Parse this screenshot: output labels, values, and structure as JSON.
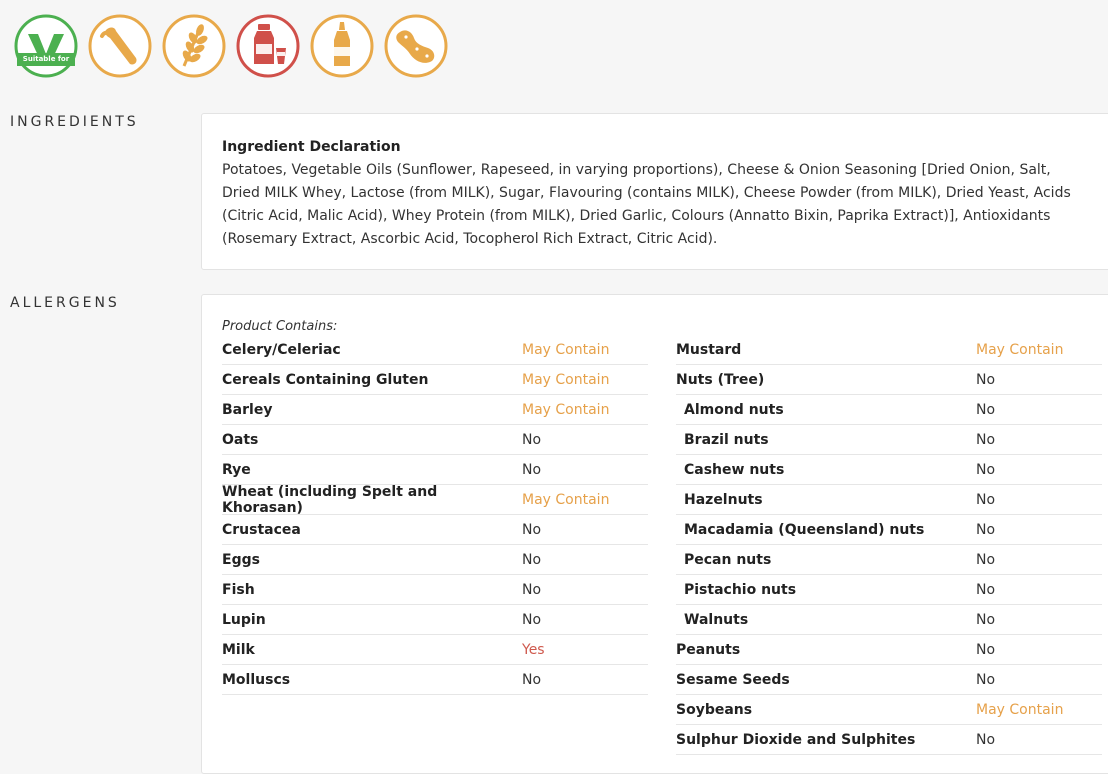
{
  "badges": {
    "vegetarian_label": "Suitable for",
    "vegetarian_letter": "V",
    "colors": {
      "green": "#4cb050",
      "amber": "#e8a94a",
      "red": "#d0504a"
    }
  },
  "ingredients": {
    "section_label": "INGREDIENTS",
    "title": "Ingredient Declaration",
    "text": "Potatoes, Vegetable Oils (Sunflower, Rapeseed, in varying proportions), Cheese & Onion Seasoning [Dried Onion, Salt, Dried MILK Whey, Lactose (from MILK), Sugar, Flavouring (contains MILK), Cheese Powder (from MILK), Dried Yeast, Acids (Citric Acid, Malic Acid), Whey Protein (from MILK), Dried Garlic, Colours (Annatto Bixin, Paprika Extract)], Antioxidants (Rosemary Extract, Ascorbic Acid, Tocopherol Rich Extract, Citric Acid)."
  },
  "allergens": {
    "section_label": "ALLERGENS",
    "contains_label": "Product Contains:",
    "left": [
      {
        "name": "Celery/Celeriac",
        "value": "May Contain",
        "status": "may",
        "sub": false
      },
      {
        "name": "Cereals Containing Gluten",
        "value": "May Contain",
        "status": "may",
        "sub": false
      },
      {
        "name": "Barley",
        "value": "May Contain",
        "status": "may",
        "sub": false
      },
      {
        "name": "Oats",
        "value": "No",
        "status": "no",
        "sub": false
      },
      {
        "name": "Rye",
        "value": "No",
        "status": "no",
        "sub": false
      },
      {
        "name": "Wheat (including Spelt and Khorasan)",
        "value": "May Contain",
        "status": "may",
        "sub": false
      },
      {
        "name": "Crustacea",
        "value": "No",
        "status": "no",
        "sub": false
      },
      {
        "name": "Eggs",
        "value": "No",
        "status": "no",
        "sub": false
      },
      {
        "name": "Fish",
        "value": "No",
        "status": "no",
        "sub": false
      },
      {
        "name": "Lupin",
        "value": "No",
        "status": "no",
        "sub": false
      },
      {
        "name": "Milk",
        "value": "Yes",
        "status": "yes",
        "sub": false
      },
      {
        "name": "Molluscs",
        "value": "No",
        "status": "no",
        "sub": false
      }
    ],
    "right": [
      {
        "name": "Mustard",
        "value": "May Contain",
        "status": "may",
        "sub": false
      },
      {
        "name": "Nuts (Tree)",
        "value": "No",
        "status": "no",
        "sub": false
      },
      {
        "name": "Almond nuts",
        "value": "No",
        "status": "no",
        "sub": true
      },
      {
        "name": "Brazil nuts",
        "value": "No",
        "status": "no",
        "sub": true
      },
      {
        "name": "Cashew nuts",
        "value": "No",
        "status": "no",
        "sub": true
      },
      {
        "name": "Hazelnuts",
        "value": "No",
        "status": "no",
        "sub": true
      },
      {
        "name": "Macadamia (Queensland) nuts",
        "value": "No",
        "status": "no",
        "sub": true
      },
      {
        "name": "Pecan nuts",
        "value": "No",
        "status": "no",
        "sub": true
      },
      {
        "name": "Pistachio nuts",
        "value": "No",
        "status": "no",
        "sub": true
      },
      {
        "name": "Walnuts",
        "value": "No",
        "status": "no",
        "sub": true
      },
      {
        "name": "Peanuts",
        "value": "No",
        "status": "no",
        "sub": false
      },
      {
        "name": "Sesame Seeds",
        "value": "No",
        "status": "no",
        "sub": false
      },
      {
        "name": "Soybeans",
        "value": "May Contain",
        "status": "may",
        "sub": false
      },
      {
        "name": "Sulphur Dioxide and Sulphites",
        "value": "No",
        "status": "no",
        "sub": false
      }
    ]
  }
}
